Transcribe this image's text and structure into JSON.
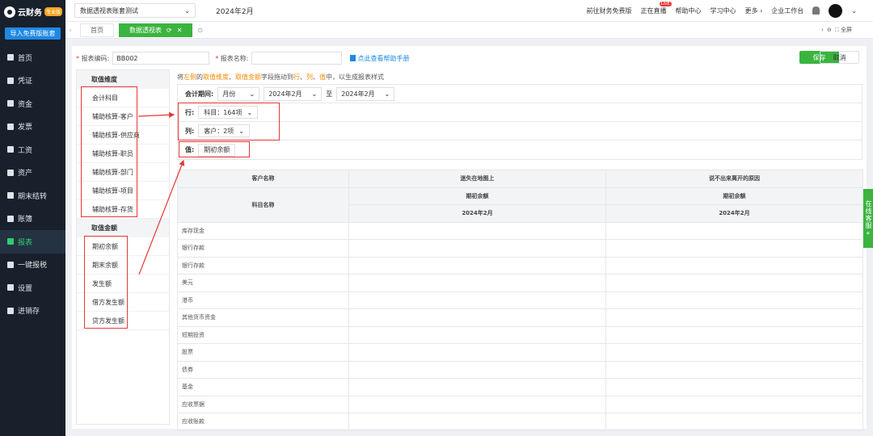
{
  "sidebar": {
    "logo_text": "云财务",
    "logo_badge": "专业版",
    "import_button": "导入免费版账套",
    "items": [
      {
        "label": "首页",
        "icon": "home-icon"
      },
      {
        "label": "凭证",
        "icon": "voucher-icon"
      },
      {
        "label": "资金",
        "icon": "fund-icon"
      },
      {
        "label": "发票",
        "icon": "invoice-icon"
      },
      {
        "label": "工资",
        "icon": "salary-icon"
      },
      {
        "label": "资产",
        "icon": "asset-icon"
      },
      {
        "label": "期末结转",
        "icon": "closing-icon"
      },
      {
        "label": "账簿",
        "icon": "ledger-icon"
      },
      {
        "label": "报表",
        "icon": "report-icon",
        "active": true
      },
      {
        "label": "一键报税",
        "icon": "tax-icon"
      },
      {
        "label": "设置",
        "icon": "settings-icon"
      },
      {
        "label": "进销存",
        "icon": "inventory-icon"
      }
    ]
  },
  "header": {
    "ledger_name": "数据透视表账套测试",
    "period": "2024年2月",
    "links": [
      "前往财务免费版",
      "正在直播",
      "帮助中心",
      "学习中心",
      "更多",
      "企业工作台"
    ],
    "live_badge": "LIVE"
  },
  "tabs": {
    "items": [
      {
        "label": "首页"
      },
      {
        "label": "数据透视表"
      }
    ],
    "fullscreen": "全屏"
  },
  "form": {
    "code_label": "报表编码:",
    "code_value": "BB002",
    "name_label": "报表名称:",
    "name_value": "",
    "help_link": "点此查看帮助手册",
    "save": "保存",
    "cancel": "取消"
  },
  "fields": {
    "dimension_head": "取值维度",
    "dimensions": [
      "会计科目",
      "辅助核算-客户",
      "辅助核算-供应商",
      "辅助核算-职员",
      "辅助核算-部门",
      "辅助核算-项目",
      "辅助核算-存货"
    ],
    "amount_head": "取值金额",
    "amounts": [
      "期初余额",
      "期末余额",
      "发生额",
      "借方发生额",
      "贷方发生额"
    ]
  },
  "hint": {
    "p1": "将",
    "p2": "左侧",
    "p3": "的",
    "p4": "取值维度",
    "p5": "、",
    "p6": "取值金额",
    "p7": "字段拖动到",
    "p8": "行",
    "p9": "、",
    "p10": "列",
    "p11": "、",
    "p12": "值",
    "p13": "中，以生成报表样式"
  },
  "config": {
    "period_label": "会计期间:",
    "period_type": "月份",
    "period_from": "2024年2月",
    "to_label": "至",
    "period_to": "2024年2月",
    "row_label": "行:",
    "row_chip": "科目：164项",
    "col_label": "列:",
    "col_chip": "客户：2项",
    "value_label": "值:",
    "value_chip": "期初余额"
  },
  "table": {
    "corner_top": "客户名称",
    "corner_bottom": "科目名称",
    "customers": [
      "迷失在地图上",
      "说不出来离开的原因"
    ],
    "measure": "期初余额",
    "period": "2024年2月",
    "rows": [
      "库存现金",
      "银行存款",
      "银行存款",
      "美元",
      "港币",
      "其他货币资金",
      "短期投资",
      "股票",
      "债券",
      "基金",
      "应收票据",
      "应收账款"
    ]
  },
  "service": {
    "label": "在线客服"
  }
}
